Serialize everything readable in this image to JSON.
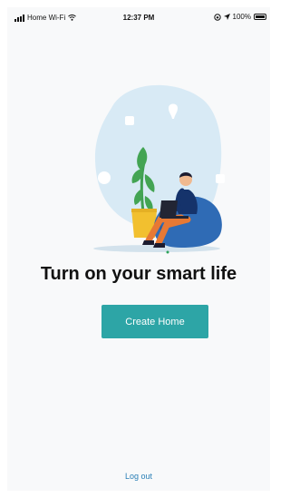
{
  "status_bar": {
    "carrier": "Home Wi-Fi",
    "time": "12:37 PM",
    "battery": "100%",
    "signal_level": 4,
    "battery_level": 1.0
  },
  "main": {
    "illustration_icon": "person-on-beanbag-with-laptop-illustration",
    "headline": "Turn on your smart life",
    "create_home_label": "Create Home",
    "logout_label": "Log out"
  },
  "colors": {
    "accent": "#2da5a6",
    "link": "#2a7fb6",
    "background": "#f8f9fa"
  }
}
